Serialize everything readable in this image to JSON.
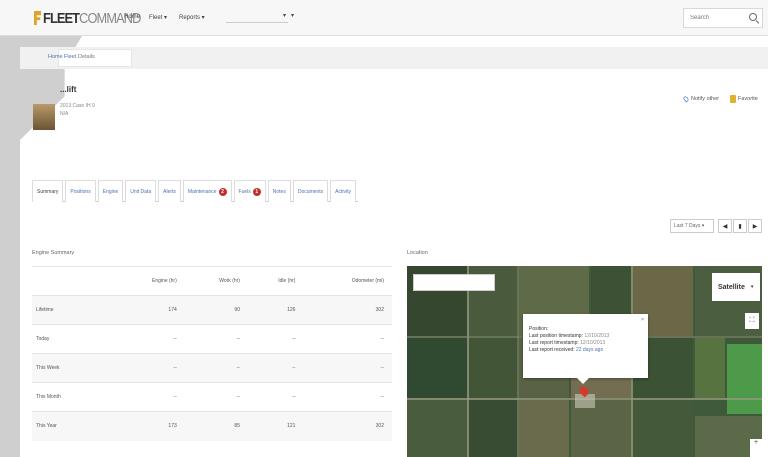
{
  "app": {
    "logo_bold": "FLEET",
    "logo_light": "COMMAND"
  },
  "nav": {
    "items": [
      "Home",
      "Fleet ▾",
      "Reports ▾"
    ],
    "select1": "▾",
    "select2": "▾",
    "search_placeholder": "Search"
  },
  "breadcrumb": [
    "Home",
    "Fleet",
    "Details"
  ],
  "asset": {
    "name": "...lift",
    "subtitle1": "2013 Case IH 9",
    "subtitle2": "N/A",
    "share_label": "Notify other",
    "favorite_label": "Favorite"
  },
  "tabs": [
    {
      "label": "Summary",
      "badge": ""
    },
    {
      "label": "Positions",
      "badge": ""
    },
    {
      "label": "Engine",
      "badge": ""
    },
    {
      "label": "Unit Data",
      "badge": ""
    },
    {
      "label": "Alerts",
      "badge": ""
    },
    {
      "label": "Maintenance",
      "badge": "2"
    },
    {
      "label": "Fuels",
      "badge": "1"
    },
    {
      "label": "Notes",
      "badge": ""
    },
    {
      "label": "Documents",
      "badge": ""
    },
    {
      "label": "Activity",
      "badge": ""
    }
  ],
  "controls": {
    "range": "Last 7 Days ▾",
    "prev": "◀",
    "export": "▮",
    "next": "▶"
  },
  "engine_summary": {
    "title": "Engine Summary",
    "columns": [
      "",
      "Engine (hr)",
      "Work (hr)",
      "Idle (hr)",
      "Odometer (mi)"
    ],
    "rows": [
      [
        "Lifetime",
        "174",
        "90",
        "126",
        "302"
      ],
      [
        "Today",
        "--",
        "--",
        "--",
        "--"
      ],
      [
        "This Week",
        "--",
        "--",
        "--",
        "--"
      ],
      [
        "This Month",
        "--",
        "--",
        "--",
        "--"
      ],
      [
        "This Year",
        "173",
        "85",
        "121",
        "302"
      ]
    ]
  },
  "location": {
    "title": "Location",
    "map_type": "Satellite",
    "map_caret": "▾",
    "fullscreen": "⛶",
    "zoom": "+",
    "popup": {
      "close": "×",
      "heading": "Position:",
      "line1_label": "Last position timestamp:",
      "line1_value": "12/10/2013",
      "line2_label": "Last report timestamp:",
      "line2_value": "12/10/2013",
      "line3_label": "Last report received:",
      "line3_value": "22 days ago"
    }
  },
  "colors": {
    "accent": "#4a72b0",
    "badge": "#c0302b",
    "logo": "#e0a32a",
    "marker": "#d23a2c"
  }
}
